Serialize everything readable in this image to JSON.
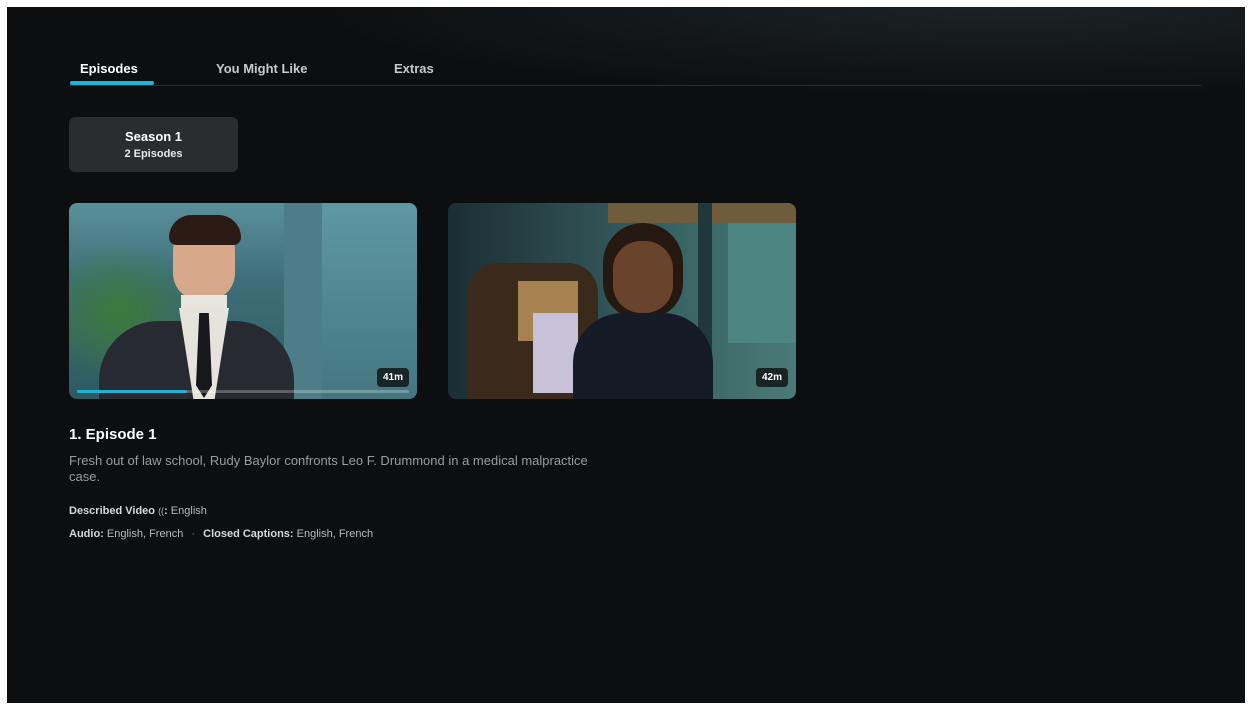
{
  "tabs": [
    {
      "label": "Episodes",
      "active": true
    },
    {
      "label": "You Might Like",
      "active": false
    },
    {
      "label": "Extras",
      "active": false
    }
  ],
  "season": {
    "title": "Season 1",
    "count": "2 Episodes"
  },
  "episodes": [
    {
      "duration": "41m",
      "progress": 0.33
    },
    {
      "duration": "42m"
    }
  ],
  "selected_episode": {
    "title": "1. Episode 1",
    "description": "Fresh out of law school, Rudy Baylor confronts Leo F. Drummond in a medical malpractice case.",
    "described_video_label": "Described Video",
    "described_video_icon": "((",
    "described_video_value": "English",
    "audio_label": "Audio:",
    "audio_value": "English, French",
    "separator": "·",
    "captions_label": "Closed Captions:",
    "captions_value": "English, French"
  },
  "colors": {
    "accent": "#1fb3d6",
    "background": "#0d0e0f"
  }
}
